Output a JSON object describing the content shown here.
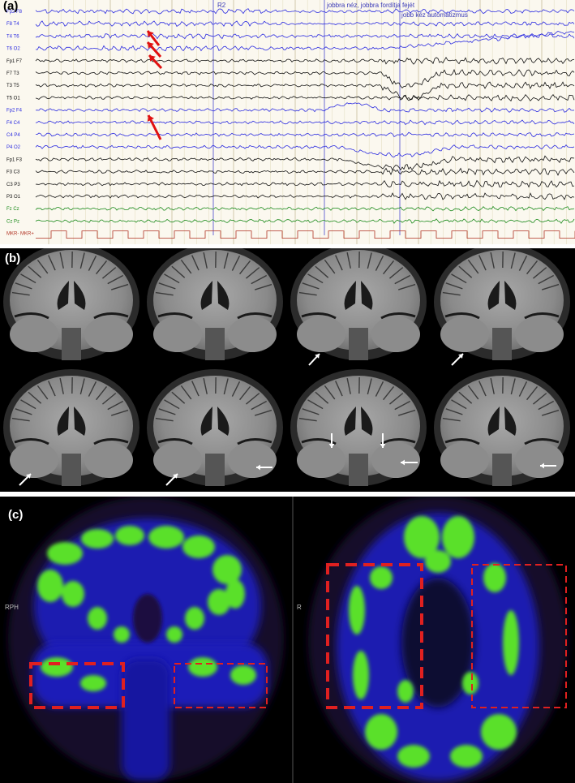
{
  "panel_a": {
    "label": "(a)",
    "channels": [
      {
        "name": "Fp2 F8",
        "color": "#2a2ae0"
      },
      {
        "name": "F8 T4",
        "color": "#2a2ae0"
      },
      {
        "name": "T4 T6",
        "color": "#2a2ae0"
      },
      {
        "name": "T6 O2",
        "color": "#2a2ae0"
      },
      {
        "name": "Fp1 F7",
        "color": "#111111"
      },
      {
        "name": "F7 T3",
        "color": "#111111"
      },
      {
        "name": "T3 T5",
        "color": "#111111"
      },
      {
        "name": "T5 O1",
        "color": "#111111"
      },
      {
        "name": "Fp2 F4",
        "color": "#2a2ae0"
      },
      {
        "name": "F4 C4",
        "color": "#2a2ae0"
      },
      {
        "name": "C4 P4",
        "color": "#2a2ae0"
      },
      {
        "name": "P4 O2",
        "color": "#2a2ae0"
      },
      {
        "name": "Fp1 F3",
        "color": "#111111"
      },
      {
        "name": "F3 C3",
        "color": "#111111"
      },
      {
        "name": "C3 P3",
        "color": "#111111"
      },
      {
        "name": "P3 O1",
        "color": "#111111"
      },
      {
        "name": "Fz Cz",
        "color": "#1a8a1a"
      },
      {
        "name": "Cz Pz",
        "color": "#1a8a1a"
      },
      {
        "name": "MKR- MKR+",
        "color": "#b03020"
      }
    ],
    "marker": "R2",
    "annotation_1": "jobbra néz, jobbra fordítja fejét",
    "annotation_2": "jobb kéz automatizmus"
  },
  "panel_b": {
    "label": "(b)"
  },
  "panel_c": {
    "label": "(c)",
    "left_orientation": "RPH",
    "right_orientation": "R"
  }
}
